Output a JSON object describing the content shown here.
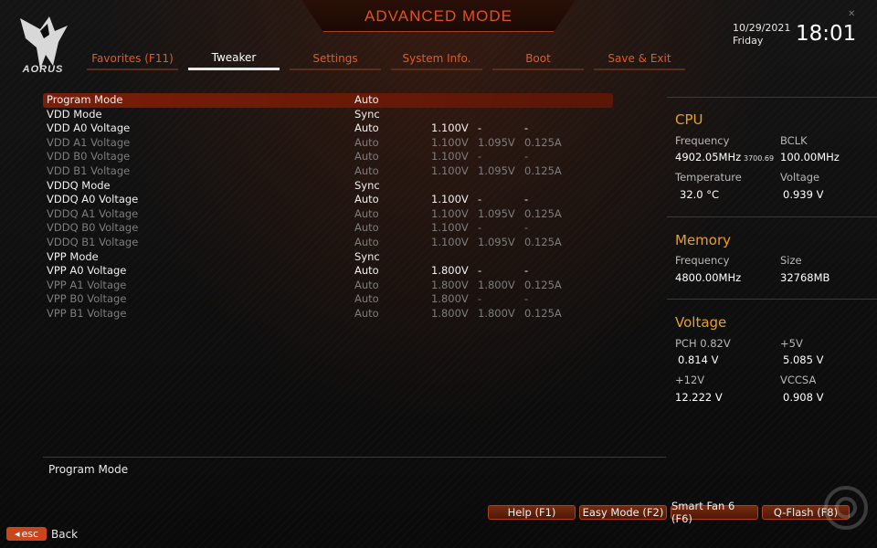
{
  "header": {
    "title": "ADVANCED MODE",
    "brand": "AORUS",
    "date": "10/29/2021",
    "day": "Friday",
    "time": "18:01"
  },
  "tabs": [
    {
      "label": "Favorites (F11)"
    },
    {
      "label": "Tweaker",
      "active": true
    },
    {
      "label": "Settings"
    },
    {
      "label": "System Info."
    },
    {
      "label": "Boot"
    },
    {
      "label": "Save & Exit"
    }
  ],
  "settings": [
    {
      "name": "Program Mode",
      "value": "Auto",
      "v1": "",
      "v2": "",
      "v3": "",
      "enabled": true,
      "selected": true
    },
    {
      "name": "VDD Mode",
      "value": "Sync",
      "v1": "",
      "v2": "",
      "v3": "",
      "enabled": true
    },
    {
      "name": "VDD A0 Voltage",
      "value": "Auto",
      "v1": "1.100V",
      "v2": "-",
      "v3": "-",
      "enabled": true
    },
    {
      "name": "VDD A1 Voltage",
      "value": "Auto",
      "v1": "1.100V",
      "v2": "1.095V",
      "v3": "0.125A",
      "enabled": false
    },
    {
      "name": "VDD B0 Voltage",
      "value": "Auto",
      "v1": "1.100V",
      "v2": "-",
      "v3": "-",
      "enabled": false
    },
    {
      "name": "VDD B1 Voltage",
      "value": "Auto",
      "v1": "1.100V",
      "v2": "1.095V",
      "v3": "0.125A",
      "enabled": false
    },
    {
      "name": "VDDQ Mode",
      "value": "Sync",
      "v1": "",
      "v2": "",
      "v3": "",
      "enabled": true
    },
    {
      "name": "VDDQ A0 Voltage",
      "value": "Auto",
      "v1": "1.100V",
      "v2": "-",
      "v3": "-",
      "enabled": true
    },
    {
      "name": "VDDQ A1 Voltage",
      "value": "Auto",
      "v1": "1.100V",
      "v2": "1.095V",
      "v3": "0.125A",
      "enabled": false
    },
    {
      "name": "VDDQ B0 Voltage",
      "value": "Auto",
      "v1": "1.100V",
      "v2": "-",
      "v3": "-",
      "enabled": false
    },
    {
      "name": "VDDQ B1 Voltage",
      "value": "Auto",
      "v1": "1.100V",
      "v2": "1.095V",
      "v3": "0.125A",
      "enabled": false
    },
    {
      "name": "VPP Mode",
      "value": "Sync",
      "v1": "",
      "v2": "",
      "v3": "",
      "enabled": true
    },
    {
      "name": "VPP A0 Voltage",
      "value": "Auto",
      "v1": "1.800V",
      "v2": "-",
      "v3": "-",
      "enabled": true
    },
    {
      "name": "VPP A1 Voltage",
      "value": "Auto",
      "v1": "1.800V",
      "v2": "1.800V",
      "v3": "0.125A",
      "enabled": false
    },
    {
      "name": "VPP B0 Voltage",
      "value": "Auto",
      "v1": "1.800V",
      "v2": "-",
      "v3": "-",
      "enabled": false
    },
    {
      "name": "VPP B1 Voltage",
      "value": "Auto",
      "v1": "1.800V",
      "v2": "1.800V",
      "v3": "0.125A",
      "enabled": false
    }
  ],
  "cpu": {
    "title": "CPU",
    "freq_label": "Frequency",
    "freq_value": "4902.05MHz",
    "freq_sub": "3700.69",
    "bclk_label": "BCLK",
    "bclk_value": "100.00MHz",
    "temp_label": "Temperature",
    "temp_value": "32.0 °C",
    "volt_label": "Voltage",
    "volt_value": "0.939 V"
  },
  "memory": {
    "title": "Memory",
    "freq_label": "Frequency",
    "freq_value": "4800.00MHz",
    "size_label": "Size",
    "size_value": "32768MB"
  },
  "voltage": {
    "title": "Voltage",
    "pch_label": "PCH 0.82V",
    "pch_value": "0.814 V",
    "p5v_label": "+5V",
    "p5v_value": "5.085 V",
    "p12v_label": "+12V",
    "p12v_value": "12.222 V",
    "vccsa_label": "VCCSA",
    "vccsa_value": "0.908 V"
  },
  "help": {
    "text": "Program Mode"
  },
  "footer": {
    "esc_label": "esc",
    "back_label": "Back",
    "buttons": [
      "Help (F1)",
      "Easy Mode (F2)",
      "Smart Fan 6 (F6)",
      "Q-Flash (F8)"
    ]
  }
}
